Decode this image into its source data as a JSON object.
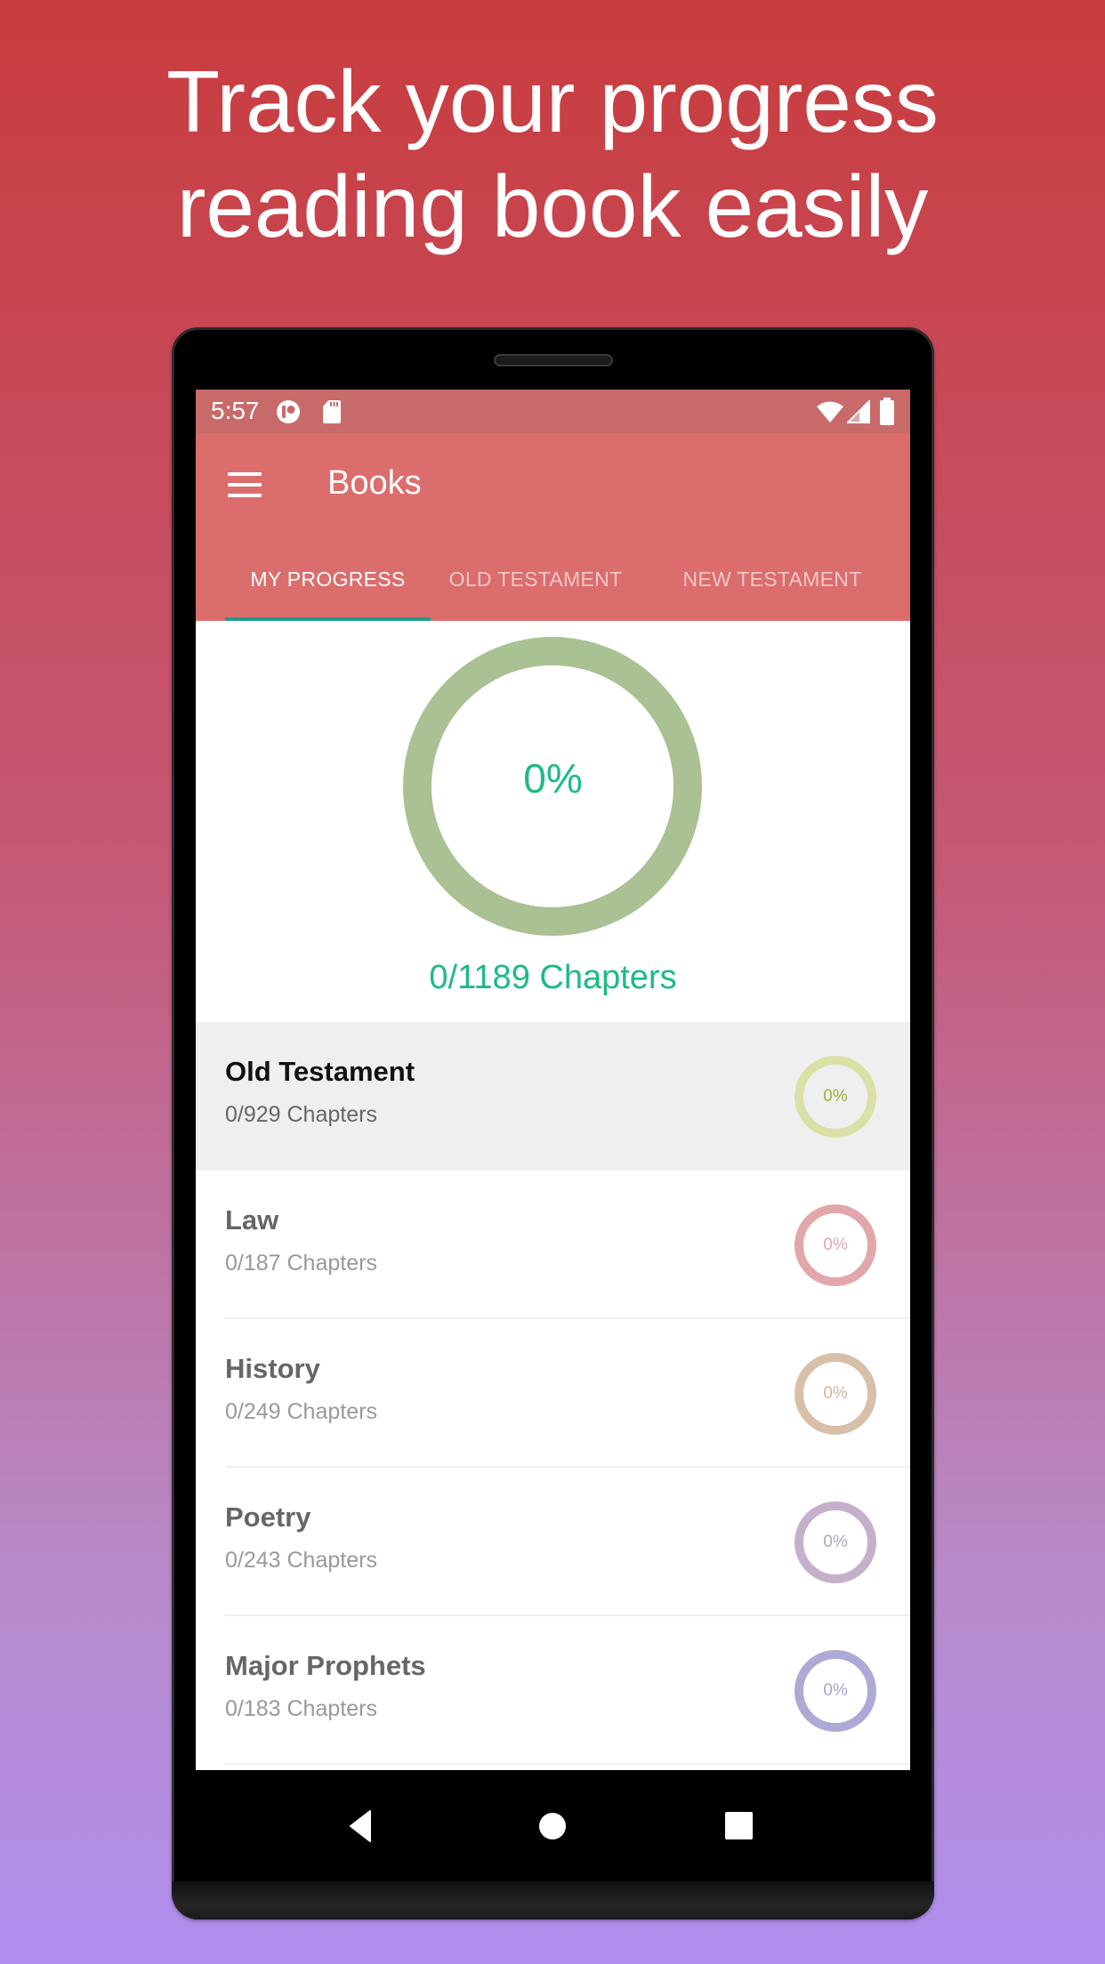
{
  "headline": {
    "line1": "Track your progress",
    "line2": "reading book easily"
  },
  "statusbar": {
    "time": "5:57",
    "left_icons": [
      "pushbullet-icon",
      "sd-card-icon"
    ],
    "right_icons": [
      "wifi-icon",
      "cellular-signal-icon",
      "battery-icon"
    ]
  },
  "appbar": {
    "menu_icon": "hamburger-menu-icon",
    "title": "Books"
  },
  "tabs": [
    {
      "label": "MY PROGRESS",
      "active": true
    },
    {
      "label": "OLD TESTAMENT",
      "active": false
    },
    {
      "label": "NEW TESTAMENT",
      "active": false
    }
  ],
  "summary": {
    "percent_label": "0%",
    "progress": 0,
    "chapters_label": "0/1189 Chapters",
    "ring_color": "#aac193",
    "text_color": "#1dbb83"
  },
  "list": [
    {
      "title": "Old Testament",
      "subtitle": "0/929 Chapters",
      "percent_label": "0%",
      "progress": 0,
      "ring_color": "#dbe0a6",
      "text_color": "#9bb33c",
      "highlighted": true
    },
    {
      "title": "Law",
      "subtitle": "0/187 Chapters",
      "percent_label": "0%",
      "progress": 0,
      "ring_color": "#e2a7ab",
      "text_color": "#e2a7ab",
      "highlighted": false
    },
    {
      "title": "History",
      "subtitle": "0/249 Chapters",
      "percent_label": "0%",
      "progress": 0,
      "ring_color": "#d7bfa8",
      "text_color": "#c9b7a6",
      "highlighted": false
    },
    {
      "title": "Poetry",
      "subtitle": "0/243 Chapters",
      "percent_label": "0%",
      "progress": 0,
      "ring_color": "#c5b0cb",
      "text_color": "#b4a7bb",
      "highlighted": false
    },
    {
      "title": "Major Prophets",
      "subtitle": "0/183 Chapters",
      "percent_label": "0%",
      "progress": 0,
      "ring_color": "#aeaad6",
      "text_color": "#a6a3cc",
      "highlighted": false
    }
  ],
  "navbar": {
    "buttons": [
      "back-icon",
      "home-icon",
      "recents-icon"
    ]
  },
  "colors": {
    "statusbar": "#c96a6a",
    "appbar": "#dc6d6d",
    "tab_indicator": "#1e9a8a"
  }
}
